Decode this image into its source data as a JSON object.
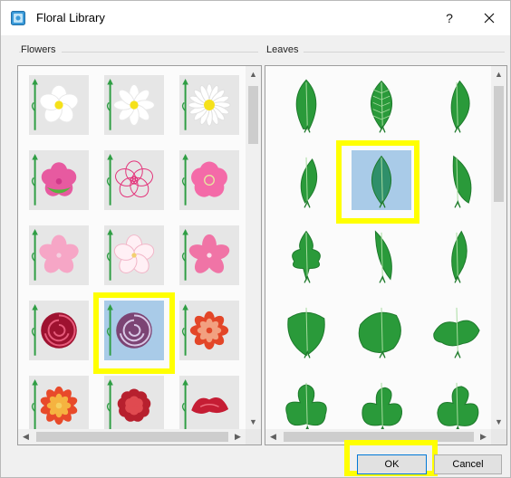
{
  "window": {
    "title": "Floral Library"
  },
  "title_buttons": {
    "help_label": "?",
    "close_label": "✕"
  },
  "flowers": {
    "label": "Flowers",
    "tiles": [
      {
        "name": "white-daisy-simple",
        "color": "#ffffff"
      },
      {
        "name": "white-daisy",
        "color": "#ffffff"
      },
      {
        "name": "white-daisy-many-petals",
        "color": "#ffffff"
      },
      {
        "name": "pink-pansy",
        "color": "#e75aa0"
      },
      {
        "name": "pink-outline-flower",
        "color": "#e3337a"
      },
      {
        "name": "pink-plum-blossom",
        "color": "#f46aa8"
      },
      {
        "name": "light-pink-cherry-blossom",
        "color": "#f6a6c6"
      },
      {
        "name": "outline-cherry-blossom",
        "color": "#f2b6c8"
      },
      {
        "name": "pink-cherry-blossom",
        "color": "#f074a6"
      },
      {
        "name": "dark-red-rose",
        "color": "#9e1230"
      },
      {
        "name": "purple-rose",
        "color": "#7c4474"
      },
      {
        "name": "red-dahlia",
        "color": "#e34628"
      },
      {
        "name": "red-orange-dahlia",
        "color": "#e84a2a"
      },
      {
        "name": "red-carnation",
        "color": "#b7202e"
      },
      {
        "name": "red-peony",
        "color": "#c51d34"
      }
    ],
    "selected_index": 10
  },
  "leaves": {
    "label": "Leaves",
    "tiles": [
      {
        "name": "pointed-leaf"
      },
      {
        "name": "veined-leaf"
      },
      {
        "name": "curved-leaf"
      },
      {
        "name": "small-curved-leaf"
      },
      {
        "name": "teal-oval-leaf"
      },
      {
        "name": "curled-leaf"
      },
      {
        "name": "oak-leaf"
      },
      {
        "name": "narrow-leaf"
      },
      {
        "name": "striped-leaf"
      },
      {
        "name": "heart-leaf"
      },
      {
        "name": "round-veined-leaf"
      },
      {
        "name": "wavy-leaf"
      },
      {
        "name": "clover-leaf"
      },
      {
        "name": "three-lobed-leaf"
      },
      {
        "name": "trefoil-leaf"
      }
    ],
    "selected_index": 4
  },
  "buttons": {
    "ok_label": "OK",
    "cancel_label": "Cancel"
  },
  "colors": {
    "highlight": "#ffff00",
    "leaf_green": "#2a9a3a",
    "stem_green": "#2f9e44",
    "selected_tile_bg": "#a9cbe8"
  }
}
